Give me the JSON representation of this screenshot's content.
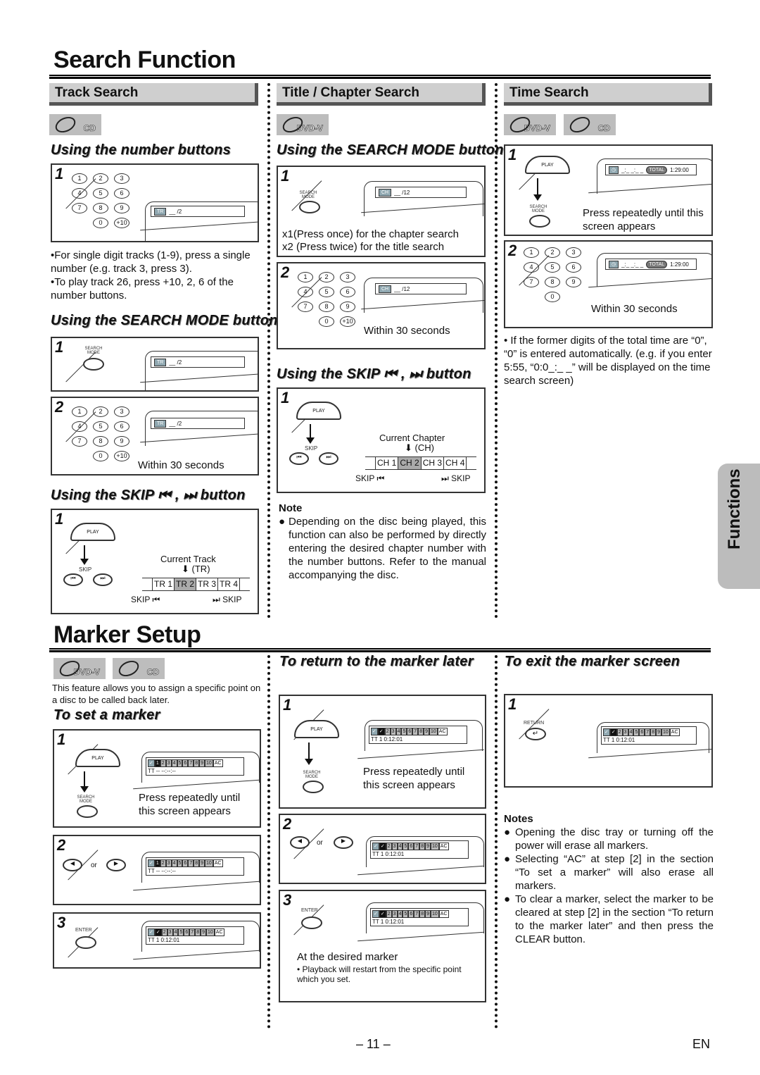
{
  "page": {
    "number_label": "– 11 –",
    "lang": "EN",
    "side_tab": "Functions"
  },
  "search_function": {
    "title": "Search Function",
    "track_search": {
      "heading": "Track Search",
      "badges": [
        "CD"
      ],
      "number_buttons": {
        "subtitle": "Using the number buttons",
        "step1": {
          "num": "1",
          "osd_tag": "TR",
          "osd_value": "__ /2"
        },
        "notes": [
          "•For single digit tracks (1-9), press a single number (e.g. track 3, press 3).",
          "•To play track 26, press +10, 2, 6 of the number buttons."
        ]
      },
      "search_mode": {
        "subtitle": "Using the SEARCH MODE button",
        "step1": {
          "num": "1",
          "button": "SEARCH MODE",
          "osd_tag": "TR",
          "osd_value": "__ /2"
        },
        "step2": {
          "num": "2",
          "osd_tag": "TR",
          "osd_value": "__ /2",
          "caption": "Within 30 seconds"
        }
      },
      "skip": {
        "subtitle": "Using the SKIP ⏮ , ⏭ button",
        "step1": {
          "num": "1",
          "play_label": "PLAY",
          "skip_label": "SKIP",
          "current_label": "Current Track",
          "abbr": "(TR)",
          "cells": [
            "TR 1",
            "TR 2",
            "TR 3",
            "TR 4"
          ],
          "current_index": 1,
          "skip_left": "SKIP ⏮",
          "skip_right": "⏭ SKIP"
        }
      }
    },
    "chapter_search": {
      "heading": "Title / Chapter Search",
      "badges": [
        "DVD-V"
      ],
      "search_mode": {
        "subtitle": "Using the SEARCH MODE button",
        "step1": {
          "num": "1",
          "button": "SEARCH MODE",
          "osd_tag": "CH",
          "osd_value": "__ /12",
          "captions": [
            "x1(Press once) for the chapter search",
            "x2 (Press twice) for the title search"
          ]
        },
        "step2": {
          "num": "2",
          "osd_tag": "CH",
          "osd_value": "__ /12",
          "caption": "Within 30 seconds"
        }
      },
      "skip": {
        "subtitle": "Using the SKIP ⏮ , ⏭ button",
        "step1": {
          "num": "1",
          "play_label": "PLAY",
          "skip_label": "SKIP",
          "current_label": "Current Chapter",
          "abbr": "(CH)",
          "cells": [
            "CH 1",
            "CH 2",
            "CH 3",
            "CH 4"
          ],
          "current_index": 1,
          "skip_left": "SKIP ⏮",
          "skip_right": "⏭ SKIP"
        }
      },
      "note": {
        "heading": "Note",
        "text": "Depending on the disc being played, this function can also be performed by directly entering the desired chapter number with the number buttons. Refer to the manual accompanying the disc."
      }
    },
    "time_search": {
      "heading": "Time Search",
      "badges": [
        "DVD-V",
        "CD"
      ],
      "step1": {
        "num": "1",
        "play_label": "PLAY",
        "button": "SEARCH MODE",
        "osd_value": "_:_ _:_ _",
        "osd_total": "TOTAL",
        "osd_time": "1:29:00",
        "caption": "Press repeatedly until this screen appears"
      },
      "step2": {
        "num": "2",
        "osd_value": "_:_ _:_ _",
        "osd_total": "TOTAL",
        "osd_time": "1:29:00",
        "caption": "Within 30 seconds"
      },
      "note": "• If the former digits of the total time are “0”, “0” is entered automatically. (e.g. if you enter 5:55, “0:0_:_ _” will be displayed on the time search screen)"
    }
  },
  "marker_setup": {
    "title": "Marker Setup",
    "badges": [
      "DVD-V",
      "CD"
    ],
    "intro": "This feature allows you to assign a specific point on a disc to be called back later.",
    "markers": [
      "1",
      "2",
      "3",
      "4",
      "5",
      "6",
      "7",
      "8",
      "9",
      "10",
      "AC"
    ],
    "set": {
      "subtitle": "To set a marker",
      "step1": {
        "num": "1",
        "play_label": "PLAY",
        "button": "SEARCH MODE",
        "osd_row2": "TT  -- --:--:--",
        "caption": "Press repeatedly until this screen appears"
      },
      "step2": {
        "num": "2",
        "or": "or",
        "osd_row2": "TT  -- --:--:--"
      },
      "step3": {
        "num": "3",
        "button": "ENTER",
        "osd_row2": "TT  1  0:12:01"
      }
    },
    "return": {
      "subtitle": "To return to the marker later",
      "step1": {
        "num": "1",
        "play_label": "PLAY",
        "button": "SEARCH MODE",
        "osd_row2": "TT  1  0:12:01",
        "caption": "Press repeatedly until this screen appears"
      },
      "step2": {
        "num": "2",
        "or": "or",
        "osd_row2": "TT  1  0:12:01"
      },
      "step3": {
        "num": "3",
        "button": "ENTER",
        "osd_row2": "TT  1  0:12:01",
        "caption": "At the desired marker",
        "sub_caption": "• Playback will restart from the specific point which you set."
      }
    },
    "exit": {
      "subtitle": "To exit the marker screen",
      "step1": {
        "num": "1",
        "button": "RETURN",
        "osd_row2": "TT  1  0:12:01"
      }
    },
    "notes": {
      "heading": "Notes",
      "items": [
        "Opening the disc tray or turning off the power will erase all markers.",
        "Selecting “AC” at step [2] in the section “To set a marker” will also erase all markers.",
        "To clear a marker, select the marker to be cleared at step [2] in the section “To return to the marker later” and then press the CLEAR button."
      ]
    }
  }
}
